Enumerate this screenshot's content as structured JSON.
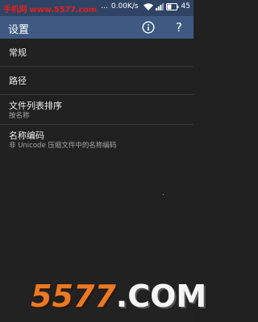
{
  "status_bar": {
    "watermark_text": "手机网 www.5577.com",
    "dots": "...",
    "network_speed": "0.00K/s",
    "battery_percent": "45",
    "battery_level": 0.45,
    "colors": {
      "background": "#2f4464",
      "watermark": "#e02020"
    }
  },
  "app_bar": {
    "title": "设置",
    "actions": [
      {
        "name": "info",
        "icon": "info-icon"
      },
      {
        "name": "help",
        "icon": "help-icon",
        "glyph": "?"
      }
    ],
    "colors": {
      "background": "#3e5a82"
    }
  },
  "settings": {
    "items": [
      {
        "title": "常规",
        "subtitle": ""
      },
      {
        "title": "路径",
        "subtitle": ""
      },
      {
        "title": "文件列表排序",
        "subtitle": "按名称"
      },
      {
        "title": "名称编码",
        "subtitle": "非 Unicode 压缩文件中的名称编码"
      }
    ]
  },
  "footer_watermark": {
    "number": "5577",
    "suffix": ".COM",
    "colors": {
      "number": "#e87a26",
      "suffix": "#f4f4f4"
    }
  }
}
